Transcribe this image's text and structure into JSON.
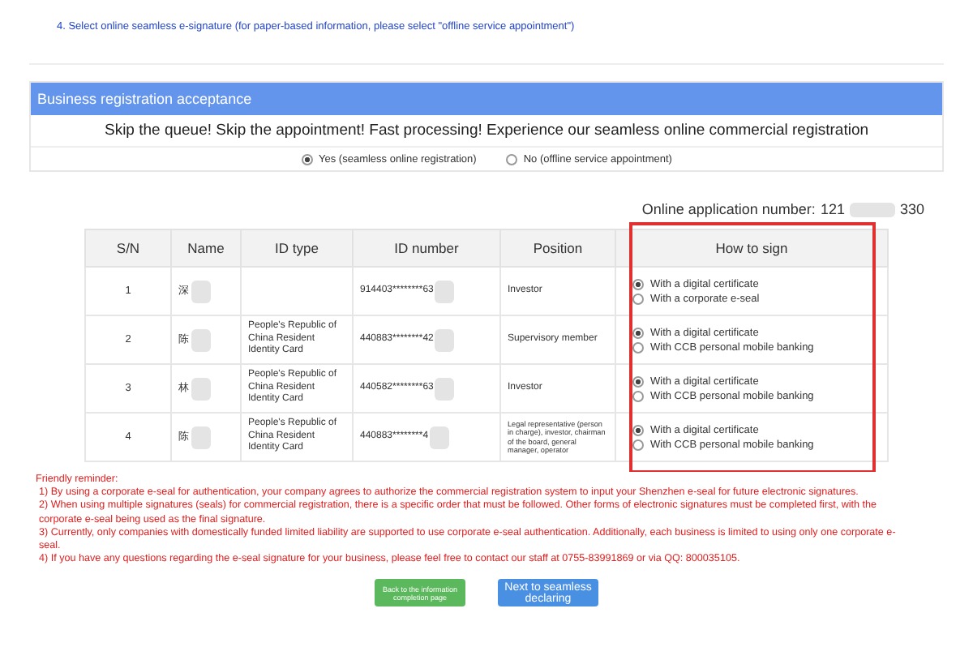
{
  "step_instruction": "4. Select online seamless e-signature (for paper-based information, please select \"offline service appointment\")",
  "panel": {
    "title": "Business registration acceptance",
    "tagline": "Skip the queue! Skip the appointment! Fast processing! Experience our seamless online commercial registration",
    "mode_options": [
      {
        "label": "Yes (seamless online registration)",
        "selected": true
      },
      {
        "label": "No (offline service appointment)",
        "selected": false
      }
    ]
  },
  "application_number": {
    "label": "Online application number:",
    "value_start": "121",
    "value_end": "330"
  },
  "table": {
    "columns": [
      "S/N",
      "Name",
      "ID type",
      "ID number",
      "Position",
      "How to sign"
    ],
    "rows": [
      {
        "sn": "1",
        "name": "深",
        "id_type": "",
        "id_number": "914403********63",
        "position": "Investor",
        "sign_options": [
          {
            "label": "With a digital certificate",
            "selected": true
          },
          {
            "label": "With a corporate e-seal",
            "selected": false
          }
        ]
      },
      {
        "sn": "2",
        "name": "陈",
        "id_type": "People's Republic of China Resident Identity Card",
        "id_number": "440883********42",
        "position": "Supervisory member",
        "sign_options": [
          {
            "label": "With a digital certificate",
            "selected": true
          },
          {
            "label": "With CCB personal mobile banking",
            "selected": false
          }
        ]
      },
      {
        "sn": "3",
        "name": "林",
        "id_type": "People's Republic of China Resident Identity Card",
        "id_number": "440582********63",
        "position": "Investor",
        "sign_options": [
          {
            "label": "With a digital certificate",
            "selected": true
          },
          {
            "label": "With CCB personal mobile banking",
            "selected": false
          }
        ]
      },
      {
        "sn": "4",
        "name": "陈",
        "id_type": "People's Republic of China Resident Identity Card",
        "id_number": "440883********4",
        "position": "Legal representative (person in charge), investor, chairman of the board, general manager, operator",
        "sign_options": [
          {
            "label": "With a digital certificate",
            "selected": true
          },
          {
            "label": "With CCB personal mobile banking",
            "selected": false
          }
        ]
      }
    ]
  },
  "reminder": {
    "title": "Friendly reminder:",
    "items": [
      "1) By using a corporate e-seal for authentication, your company agrees to authorize the commercial registration system to input your Shenzhen e-seal for future electronic signatures.",
      "2) When using multiple signatures (seals) for commercial registration, there is a specific order that must be followed. Other forms of electronic signatures must be completed first, with the corporate e-seal being used as the final signature.",
      "3) Currently, only companies with domestically funded limited liability are supported to use corporate e-seal authentication. Additionally, each business is limited to using only one corporate e-seal.",
      "4) If you have any questions regarding the e-seal signature for your business, please feel free to contact our staff at 0755-83991869 or via QQ: 800035105."
    ]
  },
  "buttons": [
    {
      "label": "Back to the information completion page",
      "kind": "secondary"
    },
    {
      "label": "Next to seamless declaring",
      "kind": "primary"
    }
  ]
}
